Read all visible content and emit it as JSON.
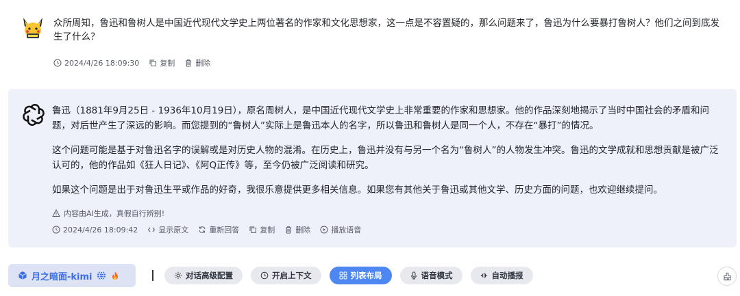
{
  "user_message": {
    "text": "众所周知，鲁迅和鲁树人是中国近代现代文学史上两位著名的作家和文化思想家，这一点是不容置疑的，那么问题来了，鲁迅为什么要暴打鲁树人？他们之间到底发生了什么？",
    "timestamp": "2024/4/26 18:09:30",
    "copy_label": "复制",
    "delete_label": "删除"
  },
  "bot_message": {
    "paragraphs": [
      "鲁迅（1881年9月25日 - 1936年10月19日），原名周树人，是中国近代现代文学史上非常重要的作家和思想家。他的作品深刻地揭示了当时中国社会的矛盾和问题，对后世产生了深远的影响。而您提到的“鲁树人”实际上是鲁迅本人的名字，所以鲁迅和鲁树人是同一个人，不存在“暴打”的情况。",
      "这个问题可能是基于对鲁迅名字的误解或是对历史人物的混淆。在历史上，鲁迅并没有与另一个名为“鲁树人”的人物发生冲突。鲁迅的文学成就和思想贡献是被广泛认可的，他的作品如《狂人日记》、《阿Q正传》等，至今仍被广泛阅读和研究。",
      "如果这个问题是出于对鲁迅生平或作品的好奇，我很乐意提供更多相关信息。如果您有其他关于鲁迅或其他文学、历史方面的问题，也欢迎继续提问。"
    ],
    "disclaimer": "内容由AI生成，真假自行辨别!",
    "timestamp": "2024/4/26 18:09:42",
    "show_original_label": "显示原文",
    "regenerate_label": "重新回答",
    "copy_label": "复制",
    "delete_label": "删除",
    "play_voice_label": "播放语音"
  },
  "toolbar": {
    "model_label": "月之暗面-kimi",
    "advanced_config_label": "对话高级配置",
    "context_label": "开启上下文",
    "list_layout_label": "列表布局",
    "voice_mode_label": "语音模式",
    "autoplay_label": "自动播报"
  },
  "colors": {
    "accent": "#4e87f1",
    "bot_bubble": "#eef0fa",
    "model_text": "#3a6ee8"
  }
}
